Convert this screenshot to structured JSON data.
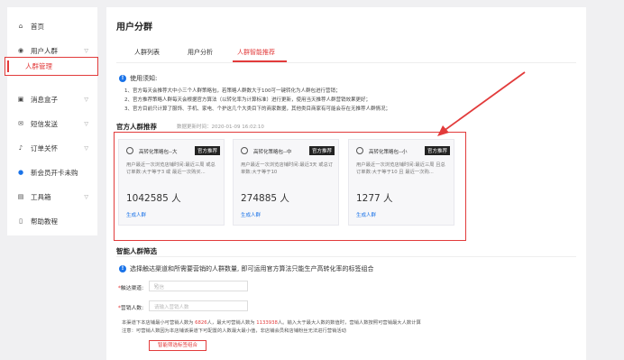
{
  "sidebar": {
    "items": [
      {
        "label": "首页",
        "icon": "home-icon",
        "glyph": "⌂"
      },
      {
        "label": "用户人群",
        "icon": "location-icon",
        "glyph": "◉"
      },
      {
        "label": "人群管理"
      },
      {
        "label": "消息盒子",
        "icon": "inbox-icon",
        "glyph": "▣"
      },
      {
        "label": "短信发送",
        "icon": "sms-icon",
        "glyph": "✉"
      },
      {
        "label": "订单关怀",
        "icon": "bell-icon",
        "glyph": "♪"
      },
      {
        "label": "新会员开卡未购",
        "icon": "user-icon",
        "glyph": "●"
      },
      {
        "label": "工具箱",
        "icon": "toolbox-icon",
        "glyph": "▤"
      },
      {
        "label": "帮助教程",
        "icon": "help-icon",
        "glyph": "▯"
      }
    ]
  },
  "main": {
    "title": "用户分群",
    "tabs": [
      "人群列表",
      "用户分析",
      "人群智能推荐"
    ],
    "notice": {
      "title": "使用须知:",
      "lines": [
        "1、官方每天会推荐大中小三个人群策略包，若策略人群数大于100可一键转化为人群包进行营销；",
        "2、官方推荐策略人群每天会根据官方算法（以转化率为计算标准）进行更新，使用当天推荐人群营销效果更好；",
        "3、官方目前只计算了服饰、手机、家电、个护这几个大类目下的商家数据，其他类目商家有可能会存在无推荐人群情况；"
      ]
    },
    "official": {
      "title": "官方人群推荐",
      "update_time": "数据更新时间：2020-01-09 16:02:10",
      "cards": [
        {
          "name": "高转化策略包--大",
          "tag": "官方推荐",
          "desc": "用户最近一次浏览店铺时间:最近三周 或总订单数:大于等于3 或 最近一次购买...",
          "count": "1042585 人",
          "action": "生成人群"
        },
        {
          "name": "高转化策略包--中",
          "tag": "官方推荐",
          "desc": "用户最近一次浏览店铺时间:最近3天 或总订单数:大于等于10",
          "count": "274885 人",
          "action": "生成人群"
        },
        {
          "name": "高转化策略包--小",
          "tag": "官方推荐",
          "desc": "用户最近一次浏览店铺时间:最近三周 且总订单数:大于等于10 且 最近一次购...",
          "count": "1277 人",
          "action": "生成人群"
        }
      ]
    },
    "smart": {
      "title": "智能人群筛选",
      "notice": "选择触达渠道和所需要营销的人群数量, 即可运用官方算法只能生产高转化率的标签组合",
      "channel_label": "触达渠道:",
      "channel_placeholder": "短信",
      "count_label": "营销人数:",
      "count_placeholder": "请输入营销人数",
      "hint1_a": "本渠道下本店铺最小可营销人数为 ",
      "hint1_min": "6826",
      "hint1_b": "人，最大可营销人数为 ",
      "hint1_max": "1133938",
      "hint1_c": "人。输入大于最大人数的数值时，营销人数按照可营销最大人数计算",
      "hint2": "注意：可营销人数因为本店铺该渠道下可配置的人数最大最小值，非店铺会员和店铺粉丝无法进行营销活动",
      "button": "智能筛选标签组合"
    }
  }
}
